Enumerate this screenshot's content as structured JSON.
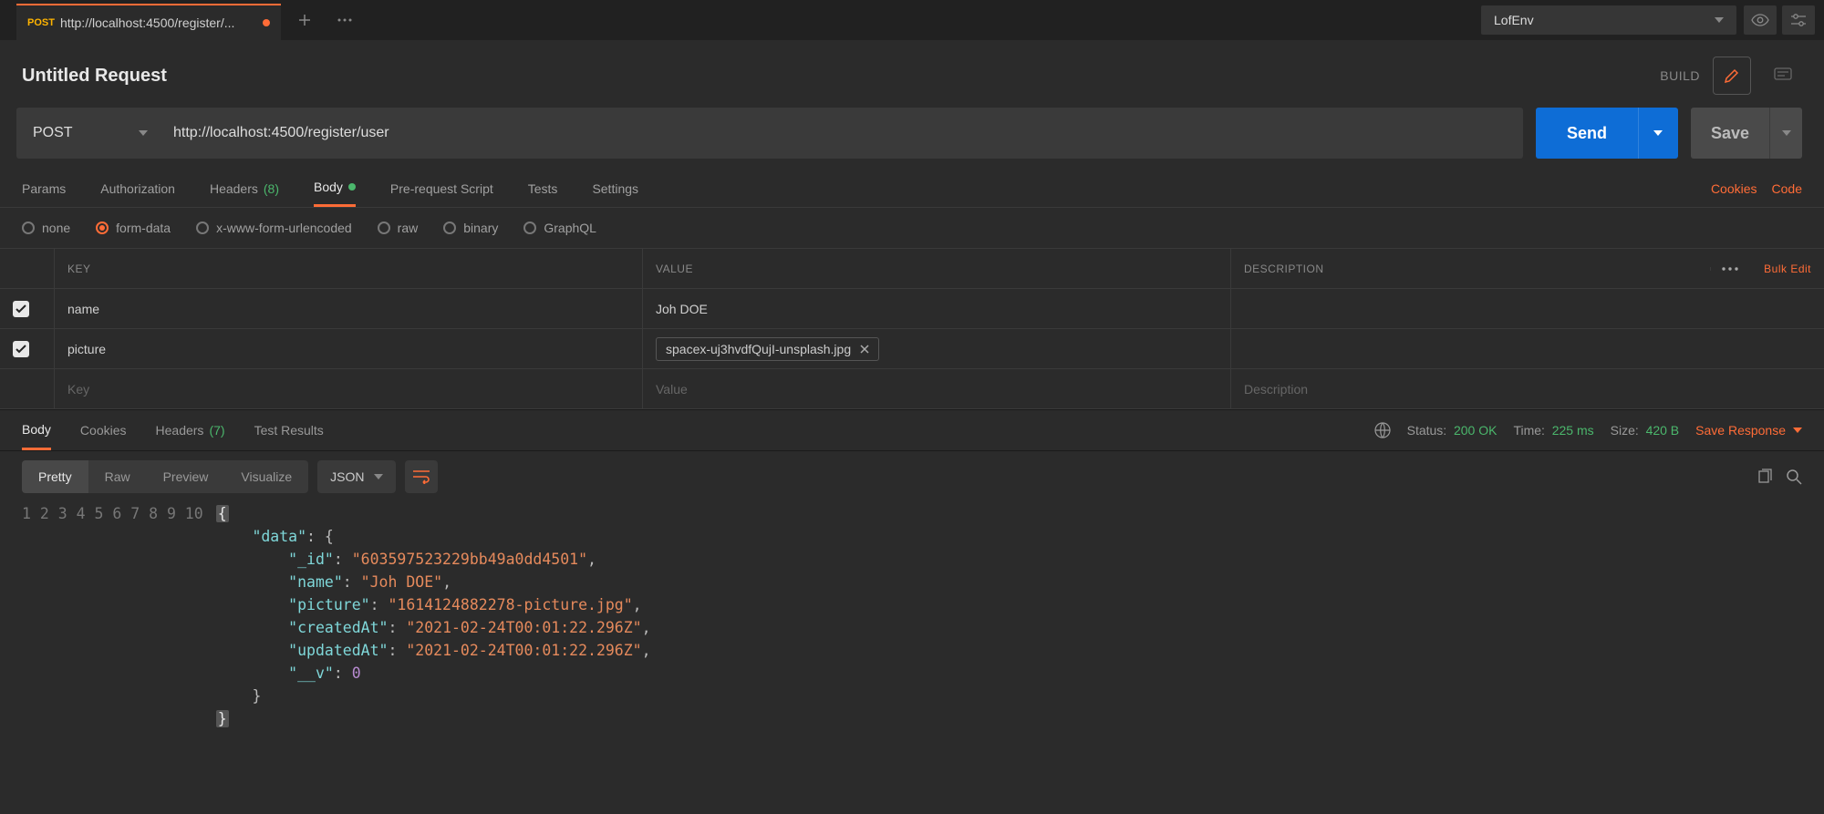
{
  "env": {
    "name": "LofEnv"
  },
  "tab": {
    "method": "POST",
    "url_short": "http://localhost:4500/register/..."
  },
  "title": "Untitled Request",
  "build_label": "BUILD",
  "request": {
    "method": "POST",
    "url": "http://localhost:4500/register/user",
    "send": "Send",
    "save": "Save"
  },
  "req_tabs": {
    "params": "Params",
    "auth": "Authorization",
    "headers": "Headers",
    "headers_count": "(8)",
    "body": "Body",
    "prereq": "Pre-request Script",
    "tests": "Tests",
    "settings": "Settings",
    "cookies": "Cookies",
    "code": "Code"
  },
  "body_types": {
    "none": "none",
    "formdata": "form-data",
    "xwww": "x-www-form-urlencoded",
    "raw": "raw",
    "binary": "binary",
    "graphql": "GraphQL"
  },
  "form_table": {
    "headers": {
      "key": "KEY",
      "value": "VALUE",
      "desc": "DESCRIPTION"
    },
    "bulk_edit": "Bulk Edit",
    "rows": [
      {
        "key": "name",
        "value": "Joh DOE",
        "file": null
      },
      {
        "key": "picture",
        "value": null,
        "file": "spacex-uj3hvdfQujI-unsplash.jpg"
      }
    ],
    "placeholders": {
      "key": "Key",
      "value": "Value",
      "desc": "Description"
    }
  },
  "resp_tabs": {
    "body": "Body",
    "cookies": "Cookies",
    "headers": "Headers",
    "headers_count": "(7)",
    "test_results": "Test Results"
  },
  "status": {
    "status_label": "Status:",
    "status_value": "200 OK",
    "time_label": "Time:",
    "time_value": "225 ms",
    "size_label": "Size:",
    "size_value": "420 B",
    "save_response": "Save Response"
  },
  "view": {
    "pretty": "Pretty",
    "raw": "Raw",
    "preview": "Preview",
    "visualize": "Visualize",
    "format": "JSON"
  },
  "response_json": {
    "data": {
      "_id": "603597523229bb49a0dd4501",
      "name": "Joh DOE",
      "picture": "1614124882278-picture.jpg",
      "createdAt": "2021-02-24T00:01:22.296Z",
      "updatedAt": "2021-02-24T00:01:22.296Z",
      "__v": 0
    }
  }
}
